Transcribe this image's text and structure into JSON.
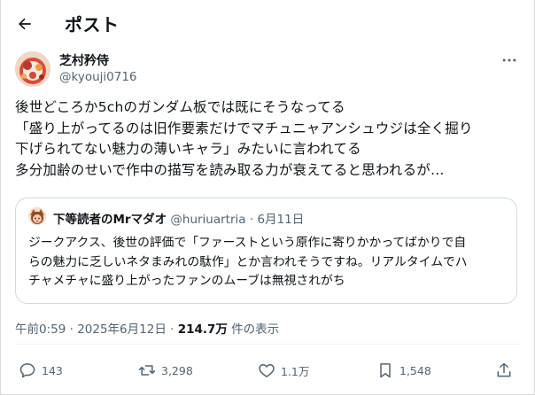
{
  "header": {
    "title": "ポスト",
    "back_icon": "arrow-left-icon"
  },
  "author": {
    "name": "芝村矜侍",
    "handle": "@kyouji0716",
    "avatar": "avatar-image"
  },
  "tweet": {
    "lines": [
      "後世どころか5chのガンダム板では既にそうなってる",
      "「盛り上がってるのは旧作要素だけでマチュニャアンシュウジは全く掘り",
      "下げられてない魅力の薄いキャラ」みたいに言われてる",
      "多分加齢のせいで作中の描写を読み取る力が衰えてると思われるが…"
    ]
  },
  "quote": {
    "name": "下等読者のMrマダオ",
    "handle": "@huriuartria",
    "separator": "·",
    "date": "6月11日",
    "lines": [
      "ジークアクス、後世の評価で「ファーストという原作に寄りかかってばかりで自",
      "らの魅力に乏しいネタまみれの駄作」とか言われそうですね。リアルタイムでハ",
      "チャメチャに盛り上がったファンのムーブは無視されがち"
    ]
  },
  "meta": {
    "time_date": "午前0:59 · 2025年6月12日 · ",
    "views": "214.7万",
    "views_label": " 件の表示"
  },
  "actions": {
    "replies": "143",
    "reposts": "3,298",
    "likes": "1.1万",
    "bookmarks": "1,548"
  },
  "colors": {
    "text": "#0f1419",
    "secondary": "#536471",
    "border": "#cfd9de"
  }
}
